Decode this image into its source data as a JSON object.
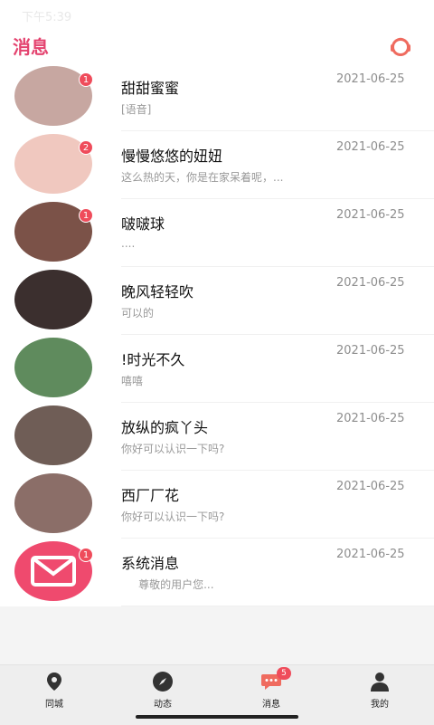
{
  "status_bar": {
    "time": "下午5:39",
    "right": ""
  },
  "header": {
    "title": "消息",
    "customer_service_icon": "headset-icon"
  },
  "messages": [
    {
      "name": "甜甜蜜蜜",
      "preview": "[语音]",
      "time": "2021-06-25",
      "badge": "1",
      "avatar_color": "#c7a7a1"
    },
    {
      "name": "慢慢悠悠的妞妞",
      "preview": "这么热的天，你是在家呆着呢，...",
      "time": "2021-06-25",
      "badge": "2",
      "avatar_color": "#f0c8bf"
    },
    {
      "name": "啵啵球",
      "preview": "....",
      "time": "2021-06-25",
      "badge": "1",
      "avatar_color": "#7b5248"
    },
    {
      "name": "晚风轻轻吹",
      "preview": "可以的",
      "time": "2021-06-25",
      "badge": "",
      "avatar_color": "#3b2f2e"
    },
    {
      "name": "!时光不久",
      "preview": "嘻嘻",
      "time": "2021-06-25",
      "badge": "",
      "avatar_color": "#5f8b5d"
    },
    {
      "name": "放纵的疯丫头",
      "preview": "你好可以认识一下吗?",
      "time": "2021-06-25",
      "badge": "",
      "avatar_color": "#6f5d56"
    },
    {
      "name": "西厂厂花",
      "preview": "你好可以认识一下吗?",
      "time": "2021-06-25",
      "badge": "",
      "avatar_color": "#8b6e68"
    },
    {
      "name": "系统消息",
      "preview": "     尊敬的用户您...",
      "time": "2021-06-25",
      "badge": "1",
      "avatar_color": "#ef4a6e"
    }
  ],
  "tabs": [
    {
      "label": "同城",
      "icon": "location-pin-icon"
    },
    {
      "label": "动态",
      "icon": "compass-icon"
    },
    {
      "label": "消息",
      "icon": "chat-bubble-icon",
      "badge": "5"
    },
    {
      "label": "我的",
      "icon": "user-icon"
    }
  ],
  "colors": {
    "accent": "#e4436f",
    "badge": "#ef4c5b",
    "system_avatar": "#ef4a6e"
  }
}
